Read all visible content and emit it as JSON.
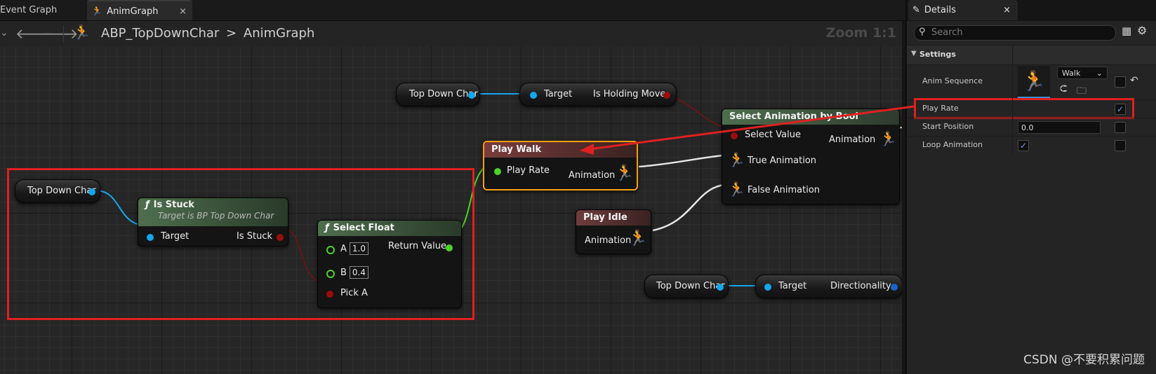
{
  "tabs": [
    {
      "label": "Event Graph",
      "active": false
    },
    {
      "label": "AnimGraph",
      "active": true,
      "close": "×"
    }
  ],
  "toolbar": {
    "back": "🡐",
    "forward": "🡒",
    "breadcrumb_root": "ABP_TopDownChar",
    "breadcrumb_sep": ">",
    "breadcrumb_leaf": "AnimGraph",
    "zoom": "Zoom 1:1"
  },
  "nodes": {
    "tdc_top": {
      "title": "Top Down Char"
    },
    "get_holding": {
      "target": "Target",
      "output": "Is Holding Move"
    },
    "select_bool": {
      "title": "Select Animation by Bool",
      "select_value": "Select Value",
      "true_anim": "True Animation",
      "false_anim": "False Animation",
      "output": "Animation"
    },
    "play_walk": {
      "title": "Play Walk",
      "play_rate": "Play Rate",
      "output": "Animation"
    },
    "play_idle": {
      "title": "Play Idle",
      "output": "Animation"
    },
    "tdc_left": {
      "title": "Top Down Char"
    },
    "is_stuck": {
      "title": "Is Stuck",
      "subtitle": "Target is BP Top Down Char",
      "target": "Target",
      "output": "Is Stuck"
    },
    "select_float": {
      "title": "Select Float",
      "a_label": "A",
      "a_value": "1.0",
      "b_label": "B",
      "b_value": "0.4",
      "pick": "Pick A",
      "output": "Return Value"
    },
    "tdc_bottom": {
      "title": "Top Down Char"
    },
    "get_dir": {
      "target": "Target",
      "output": "Directionality"
    }
  },
  "details": {
    "tab_label": "Details",
    "close": "×",
    "search_placeholder": "Search",
    "section": "Settings",
    "anim_sequence_label": "Anim Sequence",
    "anim_sequence_value": "Walk",
    "play_rate_label": "Play Rate",
    "play_rate_checked": true,
    "start_position_label": "Start Position",
    "start_position_value": "0.0",
    "loop_animation_label": "Loop Animation",
    "loop_animation_checked": true
  },
  "watermark": "CSDN @不要积累问题",
  "colors": {
    "object_pin": "#13a7ef",
    "bool_pin": "#9b0d0d",
    "float_pin": "#4bd32a",
    "highlight": "#e02020",
    "selected_outline": "#f5a00f",
    "check": "#6aa0ff"
  }
}
